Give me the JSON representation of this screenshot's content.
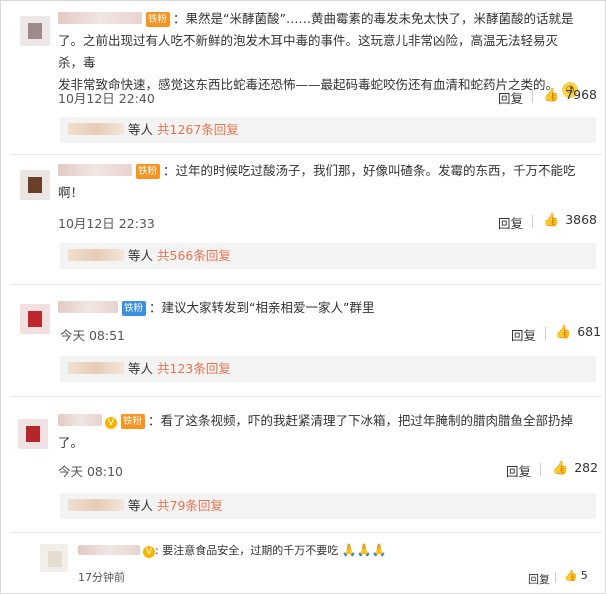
{
  "comments": [
    {
      "badge": "铁粉",
      "line1": "：果然是“米酵菌酸”……黄曲霉素的毒发未免太快了，米酵菌酸的话就是",
      "line2": "了。之前出现过有人吃不新鲜的泡发木耳中毒的事件。这玩意儿非常凶险，高温无法轻易灭杀，毒",
      "line3": "发非常致命快速，感觉这东西比蛇毒还恐怖——最起码毒蛇咬伤还有血清和蛇药片之类的。",
      "time": "10月12日 22:40",
      "reply_label": "回复",
      "likes": "7968",
      "deng": "等人",
      "replies": "共1267条回复"
    },
    {
      "badge": "铁粉",
      "line1": "：过年的时候吃过酸汤子，我们那，好像叫碴条。发霉的东西，千万不能吃",
      "line2": "啊！",
      "time": "10月12日 22:33",
      "reply_label": "回复",
      "likes": "3868",
      "deng": "等人",
      "replies": "共566条回复"
    },
    {
      "badge": "铁粉",
      "line1": "：建议大家转发到“相亲相爱一家人”群里",
      "time": "今天 08:51",
      "reply_label": "回复",
      "likes": "681",
      "deng": "等人",
      "replies": "共123条回复"
    },
    {
      "badge": "铁粉",
      "line1": "：看了这条视频，吓的我赶紧清理了下冰箱，把过年腌制的腊肉腊鱼全部扔掉",
      "line2": "了。",
      "time": "今天 08:10",
      "reply_label": "回复",
      "likes": "282",
      "deng": "等人",
      "replies": "共79条回复"
    },
    {
      "line1": "要注意食品安全，过期的千万不要吃",
      "time": "17分钟前",
      "reply_label": "回复",
      "likes": "5"
    }
  ],
  "colors": {
    "reply_count": "#eb7350",
    "fan_badge": "#f7931e",
    "fan_badge_blue": "#3b8fe0",
    "reply_box_bg": "#f3f3f3"
  }
}
